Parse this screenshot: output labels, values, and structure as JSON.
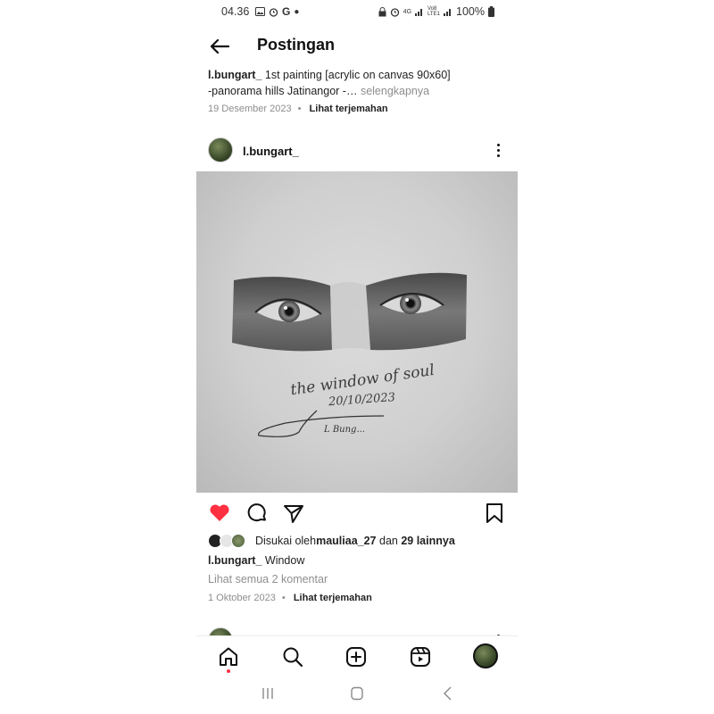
{
  "status_bar": {
    "time": "04.36",
    "left_icons": [
      "image-icon",
      "alarm-icon",
      "google-icon",
      "dot-icon"
    ],
    "google_letter": "G",
    "right_text_4g": "4G",
    "right_text_volte": "Vo8 LTE1",
    "battery": "100%"
  },
  "header": {
    "title": "Postingan"
  },
  "previous_post": {
    "username": "l.bungart_",
    "caption_line1": " 1st painting [acrylic on canvas 90x60]",
    "caption_line2": "-panorama hills Jatinangor -…",
    "more_label": "selengkapnya",
    "date": "19 Desember 2023",
    "separator": "•",
    "translate_label": "Lihat terjemahan"
  },
  "post": {
    "username": "l.bungart_",
    "artwork_text_title": "the window of soul",
    "artwork_text_date": "20/10/2023",
    "artwork_signature": "L Bung...",
    "liked": true,
    "likes_prefix": "Disukai oleh ",
    "likes_user": "mauliaa_27",
    "likes_middle": " dan ",
    "likes_others": "29 lainnya",
    "caption_user": "l.bungart_",
    "caption_text": " Window",
    "comments_label": "Lihat semua 2 komentar",
    "date": "1 Oktober 2023",
    "separator": "•",
    "translate_label": "Lihat terjemahan"
  },
  "bottom_nav": {
    "items": [
      "home-icon",
      "search-icon",
      "create-icon",
      "reels-icon",
      "profile-avatar"
    ],
    "active": "home-icon"
  },
  "colors": {
    "like_red": "#ff3040",
    "text": "#111111",
    "muted": "#8e8e8e"
  }
}
